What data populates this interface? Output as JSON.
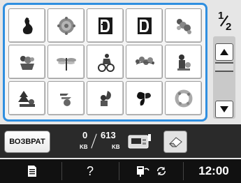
{
  "pattern_grid": {
    "cells": [
      {
        "icon": "sitting-dog-pattern-icon",
        "color": "#1a1a1a"
      },
      {
        "icon": "round-ornament-pattern-icon",
        "color": "#8a8a8a"
      },
      {
        "icon": "letter-d-monogram-pattern-icon",
        "color": "#1a1a1a"
      },
      {
        "icon": "letter-d-monogram-pattern-icon",
        "color": "#1a1a1a"
      },
      {
        "icon": "floral-spray-pattern-icon",
        "color": "#777777"
      },
      {
        "icon": "cat-basket-pattern-icon",
        "color": "#555555"
      },
      {
        "icon": "dragonfly-pattern-icon",
        "color": "#555555"
      },
      {
        "icon": "rider-pattern-icon",
        "color": "#333333"
      },
      {
        "icon": "vine-border-pattern-icon",
        "color": "#555555"
      },
      {
        "icon": "bear-pattern-icon",
        "color": "#333333"
      },
      {
        "icon": "pine-tree-pattern-icon",
        "color": "#333333"
      },
      {
        "icon": "bird-pattern-icon",
        "color": "#555555"
      },
      {
        "icon": "squirrel-pattern-icon",
        "color": "#333333"
      },
      {
        "icon": "butterfly-pattern-icon",
        "color": "#111111"
      },
      {
        "icon": "wreath-pattern-icon",
        "color": "#999999"
      }
    ]
  },
  "page_indicator": {
    "current": "1",
    "total": "2"
  },
  "scroll": {
    "up_icon": "arrow-up-icon",
    "down_icon": "arrow-down-icon"
  },
  "action_bar": {
    "back_label": "ВОЗВРАТ",
    "memory_used": "0",
    "memory_used_unit": "KB",
    "memory_total": "613",
    "memory_total_unit": "KB"
  },
  "bottom_bar": {
    "help_label": "?",
    "time": "12:00"
  },
  "colors": {
    "accent": "#2f8fe0",
    "bar_dark": "#2a2a2a",
    "bar_black": "#111111"
  }
}
